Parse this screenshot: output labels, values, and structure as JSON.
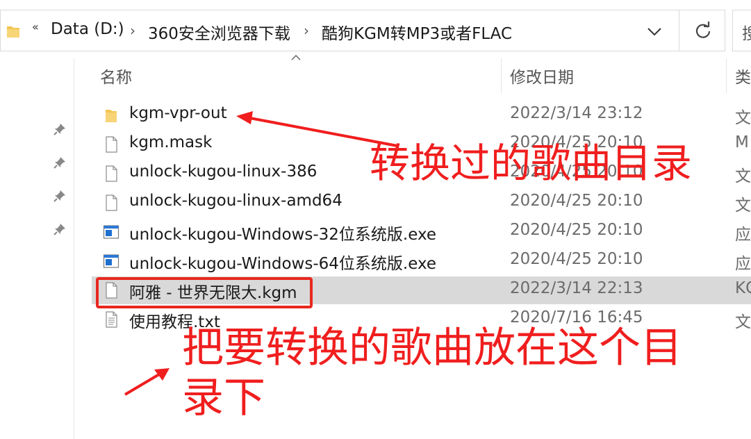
{
  "address_bar": {
    "overflow_chevron": "«",
    "breadcrumbs": [
      "Data (D:)",
      "360安全浏览器下载",
      "酷狗KGM转MP3或者FLAC"
    ],
    "separator": "›",
    "search_placeholder": "搜"
  },
  "columns": {
    "name": "名称",
    "modified": "修改日期",
    "type": "类"
  },
  "files": [
    {
      "name": "kgm-vpr-out",
      "date": "2022/3/14 23:12",
      "type": "文",
      "icon": "folder-icon"
    },
    {
      "name": "kgm.mask",
      "date": "2020/4/25 20:10",
      "type": "M",
      "icon": "file-icon"
    },
    {
      "name": "unlock-kugou-linux-386",
      "date": "2020/4/25 20:10",
      "type": "文",
      "icon": "file-icon"
    },
    {
      "name": "unlock-kugou-linux-amd64",
      "date": "2020/4/25 20:10",
      "type": "文",
      "icon": "file-icon"
    },
    {
      "name": "unlock-kugou-Windows-32位系统版.exe",
      "date": "2020/4/25 20:10",
      "type": "应",
      "icon": "exe-icon"
    },
    {
      "name": "unlock-kugou-Windows-64位系统版.exe",
      "date": "2020/4/25 20:10",
      "type": "应",
      "icon": "exe-icon"
    },
    {
      "name": "阿雅 - 世界无限大.kgm",
      "date": "2022/3/14 22:13",
      "type": "KG",
      "icon": "file-icon",
      "selected": true
    },
    {
      "name": "使用教程.txt",
      "date": "2020/7/16 16:45",
      "type": "文",
      "icon": "text-file-icon"
    }
  ],
  "annotations": {
    "output_dir_note": "转换过的歌曲目录",
    "input_dir_note": "把要转换的歌曲放在这个目录下"
  },
  "colors": {
    "annotation": "#f01e1e",
    "selection": "#d9d9d9",
    "folder": "#f4c553",
    "exe_blue": "#1e6fd0"
  }
}
